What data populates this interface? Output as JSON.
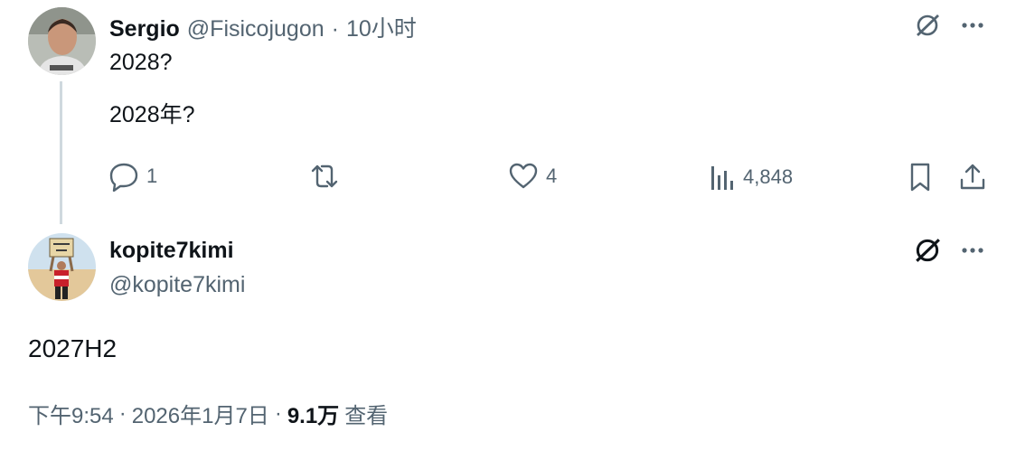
{
  "tweet": {
    "author_name": "Sergio",
    "author_handle": "@Fisicojugon",
    "separator": "·",
    "time_ago": "10小时",
    "lines": [
      "2028?",
      "2028年?"
    ],
    "stats": {
      "replies": "1",
      "likes": "4",
      "views": "4,848"
    },
    "icons": {
      "grok": "grok-icon",
      "more": "more-icon",
      "reply": "reply-icon",
      "retweet": "retweet-icon",
      "like": "like-icon",
      "views": "views-icon",
      "bookmark": "bookmark-icon",
      "share": "share-icon"
    }
  },
  "reply": {
    "author_name": "kopite7kimi",
    "author_handle": "@kopite7kimi",
    "text": "2027H2",
    "meta": {
      "time": "下午9:54",
      "sep1": "·",
      "date": "2026年1月7日",
      "sep2": "·",
      "views_count": "9.1万",
      "views_label": "查看"
    }
  },
  "colors": {
    "text": "#0f1419",
    "muted": "#536471",
    "thread_line": "#cfd9de",
    "background": "#ffffff"
  }
}
